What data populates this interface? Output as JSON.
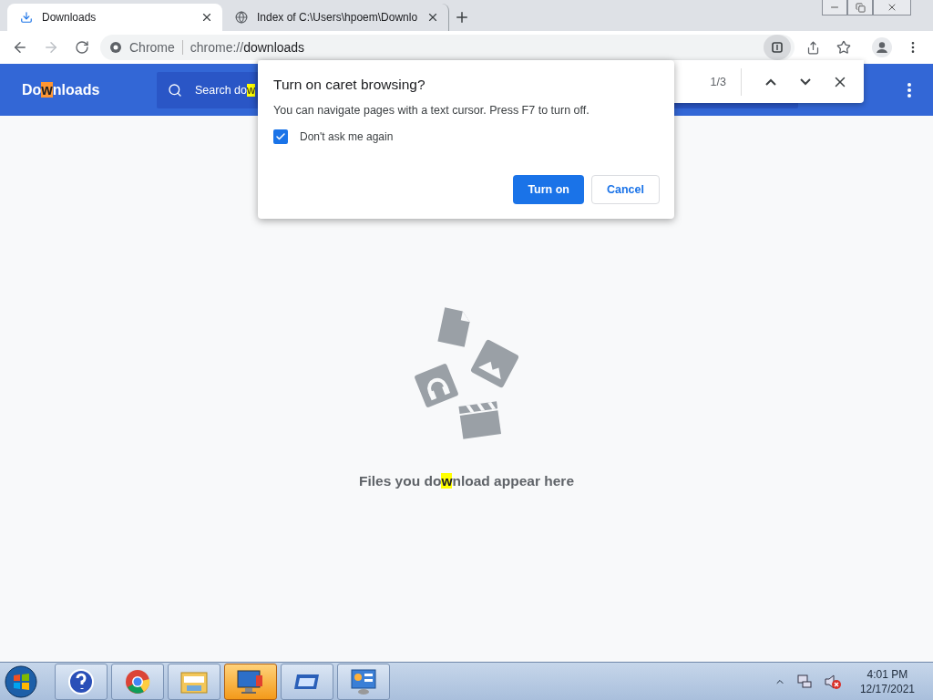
{
  "tabs": [
    {
      "title": "Downloads",
      "selected": true,
      "kind": "download"
    },
    {
      "title": "Index of C:\\Users\\hpoem\\Downlo",
      "selected": false,
      "kind": "globe"
    }
  ],
  "address": {
    "site_label": "Chrome",
    "url_scheme": "chrome://",
    "url_path": "downloads"
  },
  "page": {
    "title": {
      "before": "Do",
      "match": "w",
      "after": "nloads"
    },
    "search": {
      "before": "Search do",
      "match": "w"
    }
  },
  "find_bar": {
    "count": "1/3"
  },
  "dialog": {
    "title": "Turn on caret browsing?",
    "message": "You can navigate pages with a text cursor. Press F7 to turn off.",
    "checkbox": {
      "label": "Don't ask me again",
      "checked": true
    },
    "buttons": [
      {
        "label": "Turn on",
        "kind": "primary"
      },
      {
        "label": "Cancel",
        "kind": "secondary"
      }
    ]
  },
  "empty": {
    "message": {
      "before": "Files you do",
      "match": "w",
      "after": "nload appear here"
    }
  },
  "taskbar": {
    "apps": [
      {
        "kind": "help",
        "selected": false
      },
      {
        "kind": "chrome",
        "selected": false
      },
      {
        "kind": "folder",
        "selected": false
      },
      {
        "kind": "remote",
        "selected": true
      },
      {
        "kind": "window",
        "selected": false
      },
      {
        "kind": "panel",
        "selected": false
      }
    ],
    "time": "4:01 PM",
    "date": "12/17/2021"
  }
}
